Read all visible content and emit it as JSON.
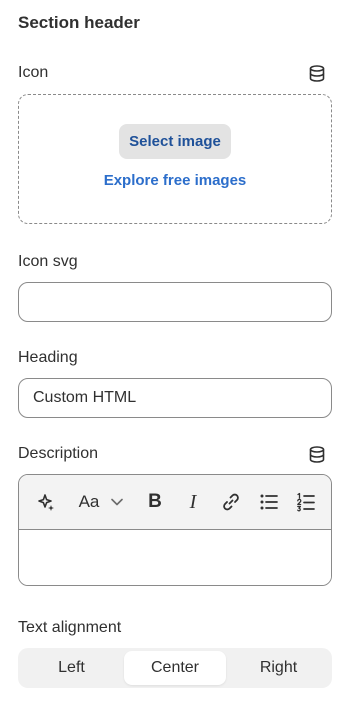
{
  "section": {
    "title": "Section header"
  },
  "icon_field": {
    "label": "Icon",
    "select_button": "Select image",
    "explore_link": "Explore free images"
  },
  "icon_svg_field": {
    "label": "Icon svg",
    "value": ""
  },
  "heading_field": {
    "label": "Heading",
    "value": "Custom HTML"
  },
  "description_field": {
    "label": "Description",
    "toolbar": {
      "magic": "sparkle-icon",
      "text_style": "Aa",
      "text_style_icon": "chevron-down-icon",
      "bold": "B",
      "italic": "I",
      "link": "link-icon",
      "bullet_list": "bulleted-list-icon",
      "numbered_list": "numbered-list-icon"
    },
    "value": ""
  },
  "alignment_field": {
    "label": "Text alignment",
    "options": [
      "Left",
      "Center",
      "Right"
    ],
    "selected": "Center"
  },
  "colors": {
    "link_blue": "#2c6ecb",
    "button_text_blue": "#1f5199",
    "border": "#8a8a8a",
    "text": "#303030"
  }
}
